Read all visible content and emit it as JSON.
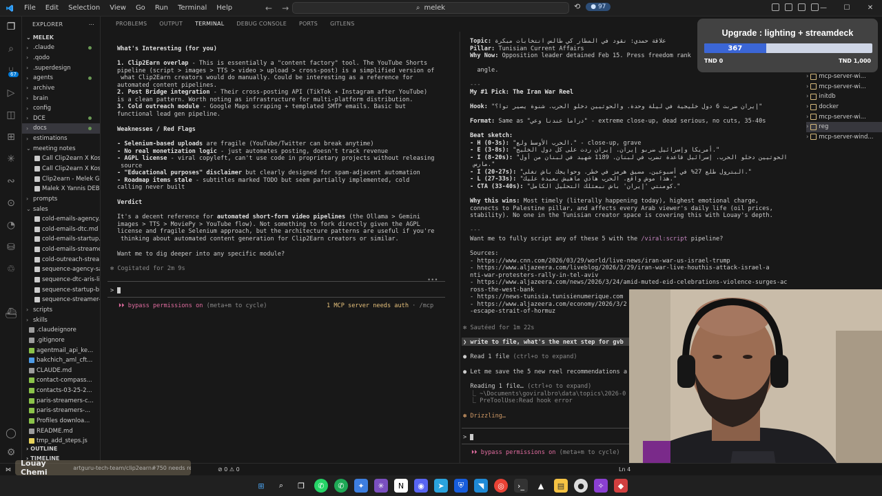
{
  "titlebar": {
    "menu": [
      "File",
      "Edit",
      "Selection",
      "View",
      "Go",
      "Run",
      "Terminal",
      "Help"
    ],
    "search": "melek",
    "badge": "97"
  },
  "activity": {
    "badge": "67"
  },
  "sidebar": {
    "header": "EXPLORER",
    "root": "MELEK",
    "items": [
      {
        "label": ".claude",
        "type": "folder"
      },
      {
        "label": ".qodo",
        "type": "folder"
      },
      {
        "label": ".superdesign",
        "type": "folder"
      },
      {
        "label": "agents",
        "type": "folder"
      },
      {
        "label": "archive",
        "type": "folder"
      },
      {
        "label": "brain",
        "type": "folder"
      },
      {
        "label": "config",
        "type": "folder"
      },
      {
        "label": "DCE",
        "type": "folder"
      },
      {
        "label": "docs",
        "type": "folder",
        "selected": true
      },
      {
        "label": "estimations",
        "type": "folder"
      },
      {
        "label": "meeting notes",
        "type": "folder-open"
      },
      {
        "label": "Call Clip2earn X Kos...",
        "type": "file"
      },
      {
        "label": "Call Clip2earn X Kos...",
        "type": "file"
      },
      {
        "label": "Clip2earn - Melek G...",
        "type": "file"
      },
      {
        "label": "Malek X Yannis DEBR...",
        "type": "file"
      },
      {
        "label": "prompts",
        "type": "folder"
      },
      {
        "label": "sales",
        "type": "folder-open"
      },
      {
        "label": "cold-emails-agency...",
        "type": "file"
      },
      {
        "label": "cold-emails-dtc.md",
        "type": "file"
      },
      {
        "label": "cold-emails-startup...",
        "type": "file"
      },
      {
        "label": "cold-emails-streame...",
        "type": "file"
      },
      {
        "label": "cold-outreach-strea...",
        "type": "file"
      },
      {
        "label": "sequence-agency-sa...",
        "type": "file"
      },
      {
        "label": "sequence-dtc-aris-lin...",
        "type": "file"
      },
      {
        "label": "sequence-startup-bil...",
        "type": "file"
      },
      {
        "label": "sequence-streamer-...",
        "type": "file"
      },
      {
        "label": "scripts",
        "type": "folder"
      },
      {
        "label": "skills",
        "type": "folder"
      },
      {
        "label": ".claudeignore",
        "type": "plain"
      },
      {
        "label": ".gitignore",
        "type": "plain"
      },
      {
        "label": "agentmail_api_ke...",
        "type": "green"
      },
      {
        "label": "bakchich_aml_cft...",
        "type": "blue"
      },
      {
        "label": "CLAUDE.md",
        "type": "plain"
      },
      {
        "label": "contact-compass...",
        "type": "green"
      },
      {
        "label": "contacts-03-25-2...",
        "type": "green"
      },
      {
        "label": "paris-streamers-c...",
        "type": "green"
      },
      {
        "label": "paris-streamers-...",
        "type": "green"
      },
      {
        "label": "Profiles downloa...",
        "type": "green"
      },
      {
        "label": "README.md",
        "type": "plain"
      },
      {
        "label": "tmp_add_steps.js",
        "type": "js"
      }
    ],
    "outline": "OUTLINE",
    "timeline": "TIMELINE"
  },
  "panel_tabs": [
    "PROBLEMS",
    "OUTPUT",
    "TERMINAL",
    "DEBUG CONSOLE",
    "PORTS",
    "GITLENS"
  ],
  "left_terminal": {
    "heading": "What's Interesting (for you)",
    "p1_bold": "1. Clip2Earn overlap",
    "p1": " - This is essentially a \"content factory\" tool. The YouTube Shorts",
    "p1b": "pipeline (script > images > TTS > video > upload > cross-post) is a simplified version of",
    "p1c": " what Clip2Earn creators would do manually. Could be interesting as a reference for",
    "p1d": "automated content pipelines.",
    "p2_bold": "2. Post Bridge integration",
    "p2": " - Their cross-posting API (TikTok + Instagram after YouTube)",
    "p2b": "is a clean pattern. Worth noting as infrastructure for multi-platform distribution.",
    "p3_bold": "3. Cold outreach module",
    "p3": " - Google Maps scraping + templated SMTP emails. Basic but",
    "p3b": "functional lead gen pipeline.",
    "weak_heading": "Weaknesses / Red Flags",
    "w1_bold": "- Selenium-based uploads",
    "w1": " are fragile (YouTube/Twitter can break anytime)",
    "w2_bold": "- No real monetization logic",
    "w2": " - just automates posting, doesn't track revenue",
    "w3_bold": "- AGPL license",
    "w3": " - viral copyleft, can't use code in proprietary projects without releasing",
    "w3b": " source",
    "w4_bold": "- \"Educational purposes\" disclaimer",
    "w4": " but clearly designed for spam-adjacent automation",
    "w5_bold": "- Roadmap items stale",
    "w5": " - subtitles marked TODO but seem partially implemented, cold",
    "w5b": "calling never built",
    "verdict_heading": "Verdict",
    "v1": "It's a decent reference for ",
    "v1_bold": "automated short-form video pipelines",
    "v1c": " (the Ollama > Gemini",
    "v2": "images > TTS > MoviePy > YouTube flow). Not something to fork directly given the AGPL",
    "v3": "license and fragile Selenium approach, but the architecture patterns are useful if you're",
    "v4": " thinking about automated content generation for Clip2Earn creators or similar.",
    "question": "Want me to dig deeper into any specific module?",
    "cogitated": "✻ Cogitated for 2m 9s",
    "prompt": ">",
    "bypass": "⏵⏵ bypass permissions on",
    "bypass_hint": " (meta+m to cycle)",
    "mcp": "1 MCP server needs auth",
    "mcp_hint": " · /mcp"
  },
  "right_terminal": {
    "topic_label": "Topic:",
    "topic": " علاقة حمدي: نقود في المطار كي طالس انتخابات مبكرة",
    "pillar_label": "Pillar:",
    "pillar": " Tunisian Current Affairs",
    "why_label": "Why Now:",
    "why": " Opposition leader detained Feb 15. Press freedom rank",
    "angle": "  angle.",
    "sep1": "---",
    "pick": "My #1 Pick: The Iran War Reel",
    "hook_label": "Hook:",
    "hook": " \"إيران ضربت 6 دول خليجية في ليلة وحدة. والحوثيين دخلو الحرب. شنوة يصير توا؟\"",
    "format_label": "Format:",
    "format": " Same as \"دراما عندنا وعي\" - extreme close-up, dead serious, no cuts, 35-40s",
    "beat_label": "Beat sketch:",
    "beat1_label": "- H (0-3s):",
    "beat1": " \"الحرب الأوسط ولع.\" - close-up, grave",
    "beat2_label": "- E (3-8s):",
    "beat2": " \"أمريكا وإسرائيل ضربو إيران. إيران ردت على كل دول الخليج.\"",
    "beat3_label": "- I (8-20s):",
    "beat3": " \"الحوثيين دخلو الحرب. إسرائيل قاعدة تضرب في لبنان. 1189 شهيد في لبنان من أول",
    "beat3b": " مارس.\"",
    "beat4_label": "- I (20-27s):",
    "beat4": " \"البترول طلع 27% في أسبوعين. مضيق هرمز في خطر. وحوايجك باش تغلى.\"",
    "beat5_label": "- L (27-33s):",
    "beat5": " \"هذا موش واقع. الحرب هاذي ماهيش بعيدة عليك.\"",
    "beat6_label": "- CTA (33-40s):",
    "beat6": " \"كومنتي 'إيران' باش نبعثلك التحليل الكامل.\"",
    "why_wins_label": "Why this wins:",
    "why_wins": " Most timely (literally happening today), highest emotional charge,",
    "why_wins2": "connects to Palestine pillar, and affects every Arab viewer's daily life (oil prices,",
    "why_wins3": "stability). No one in the Tunisian creator space is covering this with Louay's depth.",
    "sep2": "---",
    "want": "Want me to fully script any of these 5 with the ",
    "want_cmd": "/viral:script",
    "want_end": " pipeline?",
    "sources": "Sources:",
    "s1": "- https://www.cnn.com/2026/03/29/world/live-news/iran-war-us-israel-trump",
    "s2": "- https://www.aljazeera.com/liveblog/2026/3/29/iran-war-live-houthis-attack-israel-a",
    "s2b": "nti-war-protesters-rally-in-tel-aviv",
    "s3": "- https://www.aljazeera.com/news/2026/3/24/amid-muted-eid-celebrations-violence-surges-ac",
    "s3b": "ross-the-west-bank",
    "s4": "- https://news-tunisia.tunisienumerique.com",
    "s5": "- https://www.aljazeera.com/economy/2026/3/2",
    "s5b": "-escape-strait-of-hormuz",
    "sauteed": "✻ Sautéed for 1m 22s",
    "user_msg": "❯ write to file, what's the next step for gvb",
    "read": "● Read 1 file",
    "read_hint": " (ctrl+o to expand)",
    "save": "● Let me save the 5 new reel recommendations a",
    "reading": "  Reading 1 file…",
    "reading_hint": " (ctrl+o to expand)",
    "path": "  ⎿ ~\\Documents\\goviralbro\\data\\topics\\2026-0",
    "hook_err": "  ⎿ PreToolUse:Read hook error",
    "drizzling": "✽ Drizzling…",
    "prompt": ">",
    "bypass": "⏵⏵ bypass permissions on",
    "bypass_hint": " (meta+m to cycle)"
  },
  "right_tree": [
    {
      "label": "mcp-server-wi...",
      "selected": false
    },
    {
      "label": "mcp-server-wi...",
      "selected": false
    },
    {
      "label": "initdb",
      "selected": false
    },
    {
      "label": "docker",
      "selected": false
    },
    {
      "label": "mcp-server-wi...",
      "selected": false
    },
    {
      "label": "reg",
      "selected": true
    },
    {
      "label": "mcp-server-wind...",
      "selected": false
    }
  ],
  "upgrade_widget": {
    "title": "Upgrade : lighting + streamdeck",
    "current": "367",
    "min": "TND 0",
    "max": "TND 1,000",
    "progress": 0.367
  },
  "statusbar": {
    "toast_name": "Louay Chemi",
    "toast_text": "artguru-tech-team/clip2earn#750 needs reviewers",
    "errors": "⊘ 0 ⚠ 0",
    "ln": "Ln 4"
  },
  "colors": {
    "accent": "#0078d4",
    "bold_pink": "#e06c9f",
    "warn_yellow": "#e5c07b",
    "progress_fill": "#3b66d6"
  }
}
